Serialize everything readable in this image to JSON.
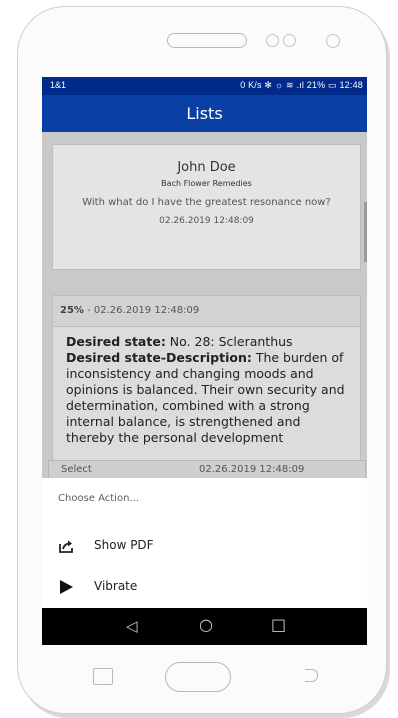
{
  "status": {
    "carrier": "1&1",
    "indicators": "0 K/s ✻ ☼ ≋ .ıl 21% ▭ 12:48"
  },
  "appbar": {
    "title": "Lists"
  },
  "card1": {
    "name": "John Doe",
    "subtitle": "Bach Flower Remedies",
    "question": "With what do I have the greatest resonance now?",
    "date": "02.26.2019 12:48:09"
  },
  "card2": {
    "percent": "25%",
    "date_text": " - 02.26.2019 12:48:09",
    "desired_state_label": "Desired state:",
    "desired_state_value": " No. 28: Scleranthus",
    "description_label": "Desired state-Description:",
    "description_value": " The burden of inconsistency and changing moods and opinions is balanced. Their own security and determination, combined with a strong internal balance, is strengthened and thereby the personal development"
  },
  "card3": {
    "label": "Select",
    "date": "02.26.2019 12:48:09"
  },
  "sheet": {
    "title": "Choose Action...",
    "items": [
      {
        "label": "Show PDF",
        "icon": "share-icon"
      },
      {
        "label": "Vibrate",
        "icon": "play-icon"
      }
    ]
  },
  "navbar": {
    "back": "◁",
    "home": "○",
    "recents": "□"
  },
  "colors": {
    "statusbar": "#002a8c",
    "appbar": "#0a3fa5",
    "scrim": "#c9c9c9"
  }
}
